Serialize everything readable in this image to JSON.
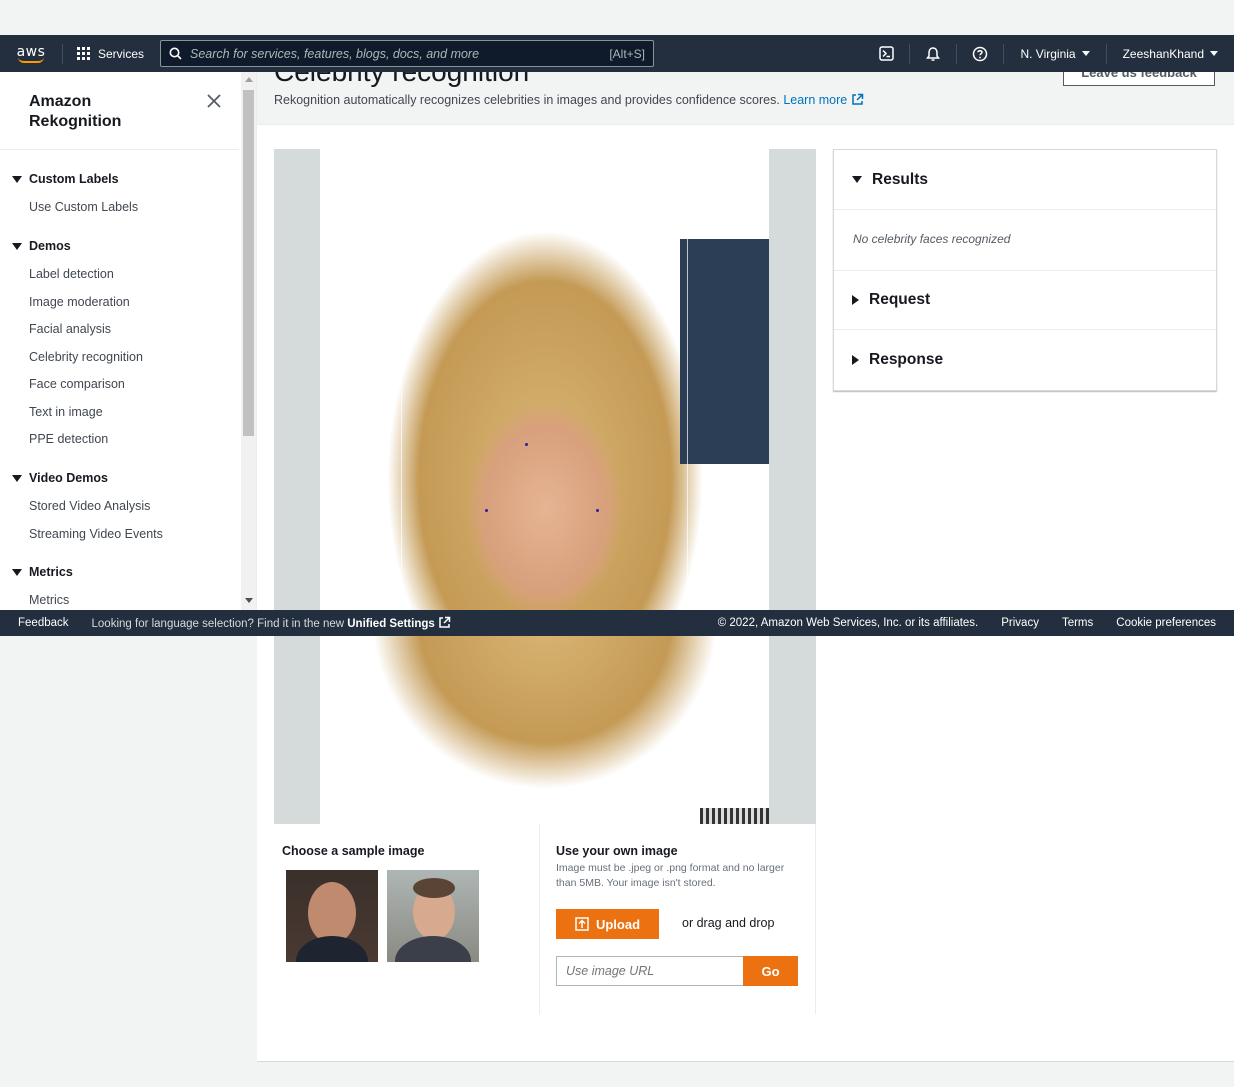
{
  "nav": {
    "logo_text": "aws",
    "services_label": "Services",
    "search_placeholder": "Search for services, features, blogs, docs, and more",
    "search_shortcut": "[Alt+S]",
    "region": "N. Virginia",
    "user": "ZeeshanKhand",
    "icons": [
      "cloudshell-icon",
      "bell-icon",
      "help-icon"
    ]
  },
  "sidebar": {
    "title": "Amazon Rekognition",
    "sections": [
      {
        "label": "Custom Labels",
        "items": [
          "Use Custom Labels"
        ]
      },
      {
        "label": "Demos",
        "items": [
          "Label detection",
          "Image moderation",
          "Facial analysis",
          "Celebrity recognition",
          "Face comparison",
          "Text in image",
          "PPE detection"
        ]
      },
      {
        "label": "Video Demos",
        "items": [
          "Stored Video Analysis",
          "Streaming Video Events"
        ]
      },
      {
        "label": "Metrics",
        "items": [
          "Metrics"
        ]
      }
    ]
  },
  "page": {
    "title": "Celebrity recognition",
    "feedback_button": "Leave us feedback",
    "description": "Rekognition automatically recognizes celebrities in images and provides confidence scores.",
    "learn_more": "Learn more"
  },
  "results_panel": {
    "results_label": "Results",
    "no_faces": "No celebrity faces recognized",
    "request_label": "Request",
    "response_label": "Response"
  },
  "footer": {
    "feedback": "Feedback",
    "language_prompt": "Looking for language selection? Find it in the new",
    "unified_settings": "Unified Settings",
    "copyright": "© 2022, Amazon Web Services, Inc. or its affiliates.",
    "privacy": "Privacy",
    "terms": "Terms",
    "cookies": "Cookie preferences"
  },
  "samples": {
    "label": "Choose a sample image"
  },
  "own_image": {
    "label": "Use your own image",
    "hint": "Image must be .jpeg or .png format and no larger than 5MB. Your image isn't stored.",
    "upload_button": "Upload",
    "drag_text": "or drag and drop",
    "url_placeholder": "Use image URL",
    "go_button": "Go"
  },
  "colors": {
    "nav_bg": "#232f3e",
    "accent_orange": "#ec7211",
    "link_blue": "#0073bb"
  }
}
